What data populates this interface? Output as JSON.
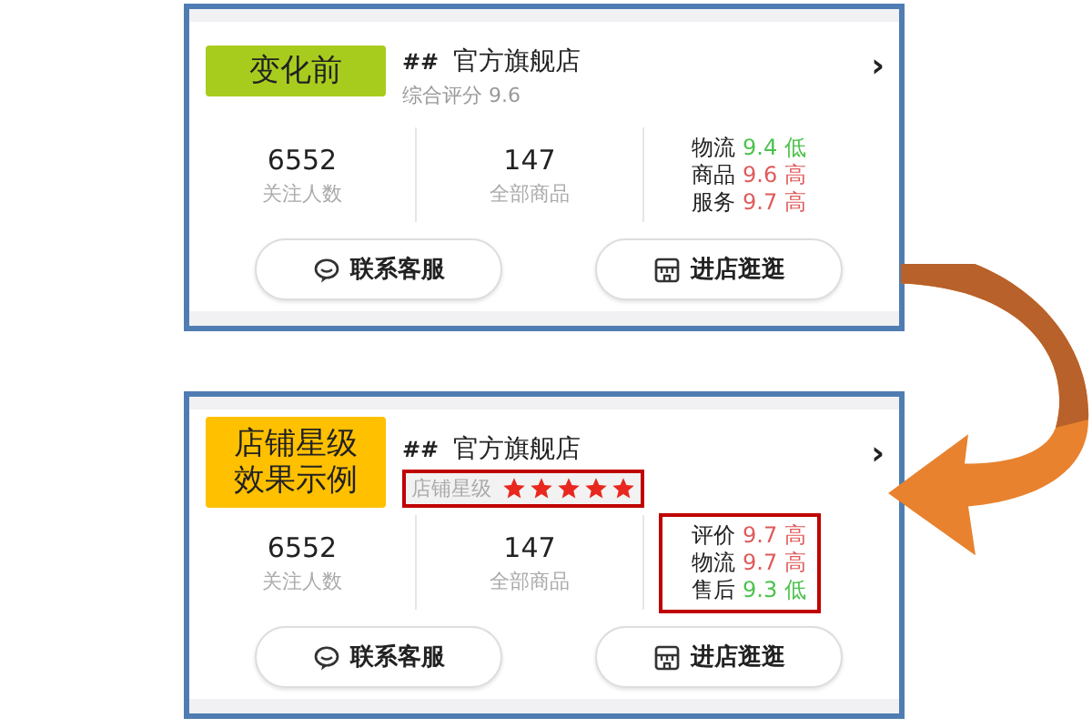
{
  "cards": [
    {
      "badge": {
        "lines": [
          "变化前"
        ],
        "color": "#a8cc1e"
      },
      "shop_prefix": "##",
      "shop_name": "官方旗舰店",
      "kind": "score",
      "score_text": "综合评分 9.6",
      "stats": [
        {
          "value": "6552",
          "label": "关注人数"
        },
        {
          "value": "147",
          "label": "全部商品"
        }
      ],
      "ratings_highlighted": false,
      "ratings": [
        {
          "label": "物流",
          "score": "9.4 低",
          "color": "#4cc24c"
        },
        {
          "label": "商品",
          "score": "9.6 高",
          "color": "#e05a5a"
        },
        {
          "label": "服务",
          "score": "9.7 高",
          "color": "#e05a5a"
        }
      ],
      "buttons": [
        {
          "label": "联系客服",
          "kind": "chat"
        },
        {
          "label": "进店逛逛",
          "kind": "store"
        }
      ],
      "chevron": "›"
    },
    {
      "badge": {
        "lines": [
          "店铺星级",
          "效果示例"
        ],
        "color": "#ffc000"
      },
      "shop_prefix": "##",
      "shop_name": "官方旗舰店",
      "kind": "stars",
      "stars_label": "店铺星级",
      "stars": 5,
      "stars_highlighted": true,
      "stats": [
        {
          "value": "6552",
          "label": "关注人数"
        },
        {
          "value": "147",
          "label": "全部商品"
        }
      ],
      "ratings_highlighted": true,
      "ratings": [
        {
          "label": "评价",
          "score": "9.7 高",
          "color": "#e05a5a"
        },
        {
          "label": "物流",
          "score": "9.7 高",
          "color": "#e05a5a"
        },
        {
          "label": "售后",
          "score": "9.3 低",
          "color": "#4cc24c"
        }
      ],
      "buttons": [
        {
          "label": "联系客服",
          "kind": "chat"
        },
        {
          "label": "进店逛逛",
          "kind": "store"
        }
      ],
      "chevron": "›"
    }
  ]
}
